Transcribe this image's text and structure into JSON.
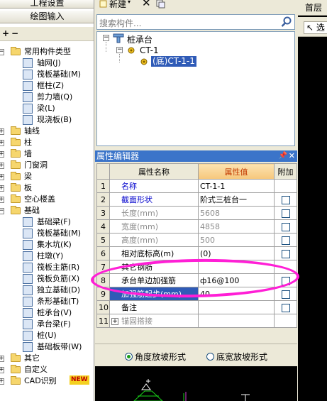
{
  "left_nav": {
    "buttons": [
      "工程设置",
      "绘图输入"
    ],
    "tree": [
      {
        "label": "常用构件类型",
        "level": 0,
        "type": "folder",
        "expanded": true
      },
      {
        "label": "轴网(J)",
        "level": 1,
        "type": "item",
        "icon": "axis-grid-icon"
      },
      {
        "label": "筏板基础(M)",
        "level": 1,
        "type": "item",
        "icon": "raft-foundation-icon"
      },
      {
        "label": "框柱(Z)",
        "level": 1,
        "type": "item",
        "icon": "frame-column-icon"
      },
      {
        "label": "剪力墙(Q)",
        "level": 1,
        "type": "item",
        "icon": "shear-wall-icon"
      },
      {
        "label": "梁(L)",
        "level": 1,
        "type": "item",
        "icon": "beam-icon"
      },
      {
        "label": "现浇板(B)",
        "level": 1,
        "type": "item",
        "icon": "cast-slab-icon"
      },
      {
        "label": "轴线",
        "level": 0,
        "type": "folder",
        "expanded": false
      },
      {
        "label": "柱",
        "level": 0,
        "type": "folder",
        "expanded": false
      },
      {
        "label": "墙",
        "level": 0,
        "type": "folder",
        "expanded": false
      },
      {
        "label": "门窗洞",
        "level": 0,
        "type": "folder",
        "expanded": false
      },
      {
        "label": "梁",
        "level": 0,
        "type": "folder",
        "expanded": false
      },
      {
        "label": "板",
        "level": 0,
        "type": "folder",
        "expanded": false
      },
      {
        "label": "空心楼盖",
        "level": 0,
        "type": "folder",
        "expanded": false
      },
      {
        "label": "基础",
        "level": 0,
        "type": "folder",
        "expanded": true
      },
      {
        "label": "基础梁(F)",
        "level": 1,
        "type": "item",
        "icon": "foundation-beam-icon"
      },
      {
        "label": "筏板基础(M)",
        "level": 1,
        "type": "item",
        "icon": "raft-foundation-icon"
      },
      {
        "label": "集水坑(K)",
        "level": 1,
        "type": "item",
        "icon": "sump-pit-icon"
      },
      {
        "label": "柱墩(Y)",
        "level": 1,
        "type": "item",
        "icon": "column-pier-icon"
      },
      {
        "label": "筏板主筋(R)",
        "level": 1,
        "type": "item",
        "icon": "raft-main-rebar-icon"
      },
      {
        "label": "筏板负筋(X)",
        "level": 1,
        "type": "item",
        "icon": "raft-negative-rebar-icon"
      },
      {
        "label": "独立基础(D)",
        "level": 1,
        "type": "item",
        "icon": "isolated-foundation-icon"
      },
      {
        "label": "条形基础(T)",
        "level": 1,
        "type": "item",
        "icon": "strip-foundation-icon"
      },
      {
        "label": "桩承台(V)",
        "level": 1,
        "type": "item",
        "icon": "pile-cap-icon"
      },
      {
        "label": "承台梁(F)",
        "level": 1,
        "type": "item",
        "icon": "cap-beam-icon"
      },
      {
        "label": "桩(U)",
        "level": 1,
        "type": "item",
        "icon": "pile-icon"
      },
      {
        "label": "基础板带(W)",
        "level": 1,
        "type": "item",
        "icon": "foundation-strip-icon"
      },
      {
        "label": "其它",
        "level": 0,
        "type": "folder",
        "expanded": false
      },
      {
        "label": "自定义",
        "level": 0,
        "type": "folder",
        "expanded": false
      },
      {
        "label": "CAD识别",
        "level": 0,
        "type": "folder",
        "expanded": false,
        "badge": "NEW"
      }
    ]
  },
  "mid_toolbar": {
    "new_label": "新建"
  },
  "search": {
    "placeholder": "搜索构件..."
  },
  "component_tree": {
    "root": "桩承台",
    "child": "CT-1",
    "leaf": "(底)CT-1-1"
  },
  "property_editor": {
    "title": "属性编辑器",
    "headers": {
      "name": "属性名称",
      "value": "属性值",
      "extra": "附加"
    },
    "rows": [
      {
        "num": "1",
        "name": "名称",
        "value": "CT-1-1",
        "name_style": "blue",
        "value_style": "normal",
        "checkbox": false
      },
      {
        "num": "2",
        "name": "截面形状",
        "value": "阶式三桩台一",
        "name_style": "blue",
        "value_style": "normal",
        "checkbox": true
      },
      {
        "num": "3",
        "name": "长度(mm)",
        "value": "5608",
        "name_style": "gray",
        "value_style": "gray",
        "checkbox": true
      },
      {
        "num": "4",
        "name": "宽度(mm)",
        "value": "4858",
        "name_style": "gray",
        "value_style": "gray",
        "checkbox": true
      },
      {
        "num": "5",
        "name": "高度(mm)",
        "value": "500",
        "name_style": "gray",
        "value_style": "gray",
        "checkbox": true
      },
      {
        "num": "6",
        "name": "相对底标高(m)",
        "value": "(0)",
        "name_style": "normal",
        "value_style": "normal",
        "checkbox": true
      },
      {
        "num": "7",
        "name": "其它钢筋",
        "value": "",
        "name_style": "normal",
        "value_style": "normal",
        "checkbox": false
      },
      {
        "num": "8",
        "name": "承台单边加强筋",
        "value": "ф16@100",
        "name_style": "normal",
        "value_style": "normal",
        "checkbox": true
      },
      {
        "num": "9",
        "name": "加强筋起步(mm)",
        "value": "40",
        "name_style": "normal",
        "value_style": "normal",
        "checkbox": true,
        "selected": true
      },
      {
        "num": "10",
        "name": "备注",
        "value": "",
        "name_style": "normal",
        "value_style": "normal",
        "checkbox": true
      },
      {
        "num": "11",
        "name": "锚固搭接",
        "value": "",
        "name_style": "gray",
        "value_style": "normal",
        "checkbox": false,
        "expander": "+"
      }
    ]
  },
  "slope_options": [
    {
      "label": "角度放坡形式",
      "selected": true
    },
    {
      "label": "底宽放坡形式",
      "selected": false
    }
  ],
  "right_panel": {
    "tab": "首层",
    "select_button": "选"
  },
  "colors": {
    "highlight_ellipse": "#ff1fd6",
    "selection": "#2f5bb7",
    "title_bar": "#3b74c9"
  }
}
